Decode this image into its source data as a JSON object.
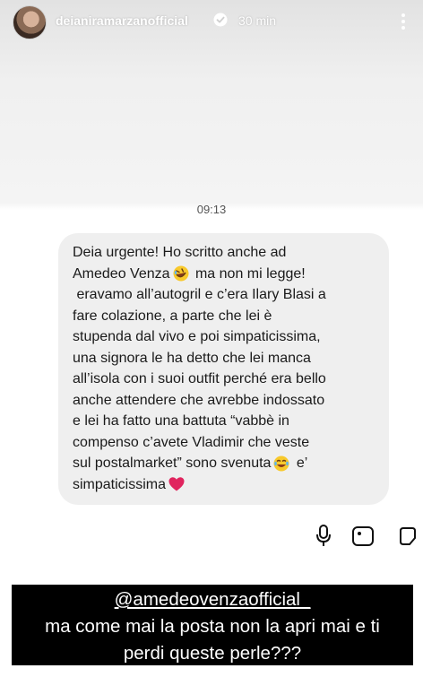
{
  "story": {
    "username": "deianiramarzanofficial",
    "time_ago": "30 min",
    "icons": [
      "avatar",
      "verified-badge-icon",
      "more-options-icon"
    ]
  },
  "chat": {
    "timestamp": "09:13",
    "message_lines": [
      {
        "text": "Deia urgente! Ho scritto anche ad",
        "emoji": ""
      },
      {
        "text": "Amedeo Venza",
        "emoji": "rofl",
        "after": " ma non mi legge!"
      },
      {
        "text": " eravamo all’autogril e c’era Ilary Blasi a",
        "emoji": ""
      },
      {
        "text": "fare colazione, a parte che lei è",
        "emoji": ""
      },
      {
        "text": "stupenda dal vivo e poi simpaticissima,",
        "emoji": ""
      },
      {
        "text": "una signora le ha detto che lei manca",
        "emoji": ""
      },
      {
        "text": "all’isola con i suoi outfit perché era bello",
        "emoji": ""
      },
      {
        "text": "anche attendere che avrebbe indossato",
        "emoji": ""
      },
      {
        "text": "e lei ha fatto una battuta “vabbè in",
        "emoji": ""
      },
      {
        "text": "compenso c’avete Vladimir che veste",
        "emoji": ""
      },
      {
        "text": "sul postalmarket” sono svenuta",
        "emoji": "joy",
        "after": " e’"
      },
      {
        "text": "simpaticissima",
        "emoji": "heart",
        "after": ""
      }
    ],
    "icons": [
      "microphone-icon",
      "gallery-icon",
      "sticker-icon"
    ]
  },
  "overlay": {
    "mention": "@amedeovenzaofficial_",
    "line1": "ma come mai la posta non la apri mai e ti",
    "line2": "perdi queste perle???"
  },
  "colors": {
    "bubble": "#efefef",
    "overlay_bg": "#000000",
    "overlay_text": "#ffffff",
    "heart": "#e0245e"
  }
}
